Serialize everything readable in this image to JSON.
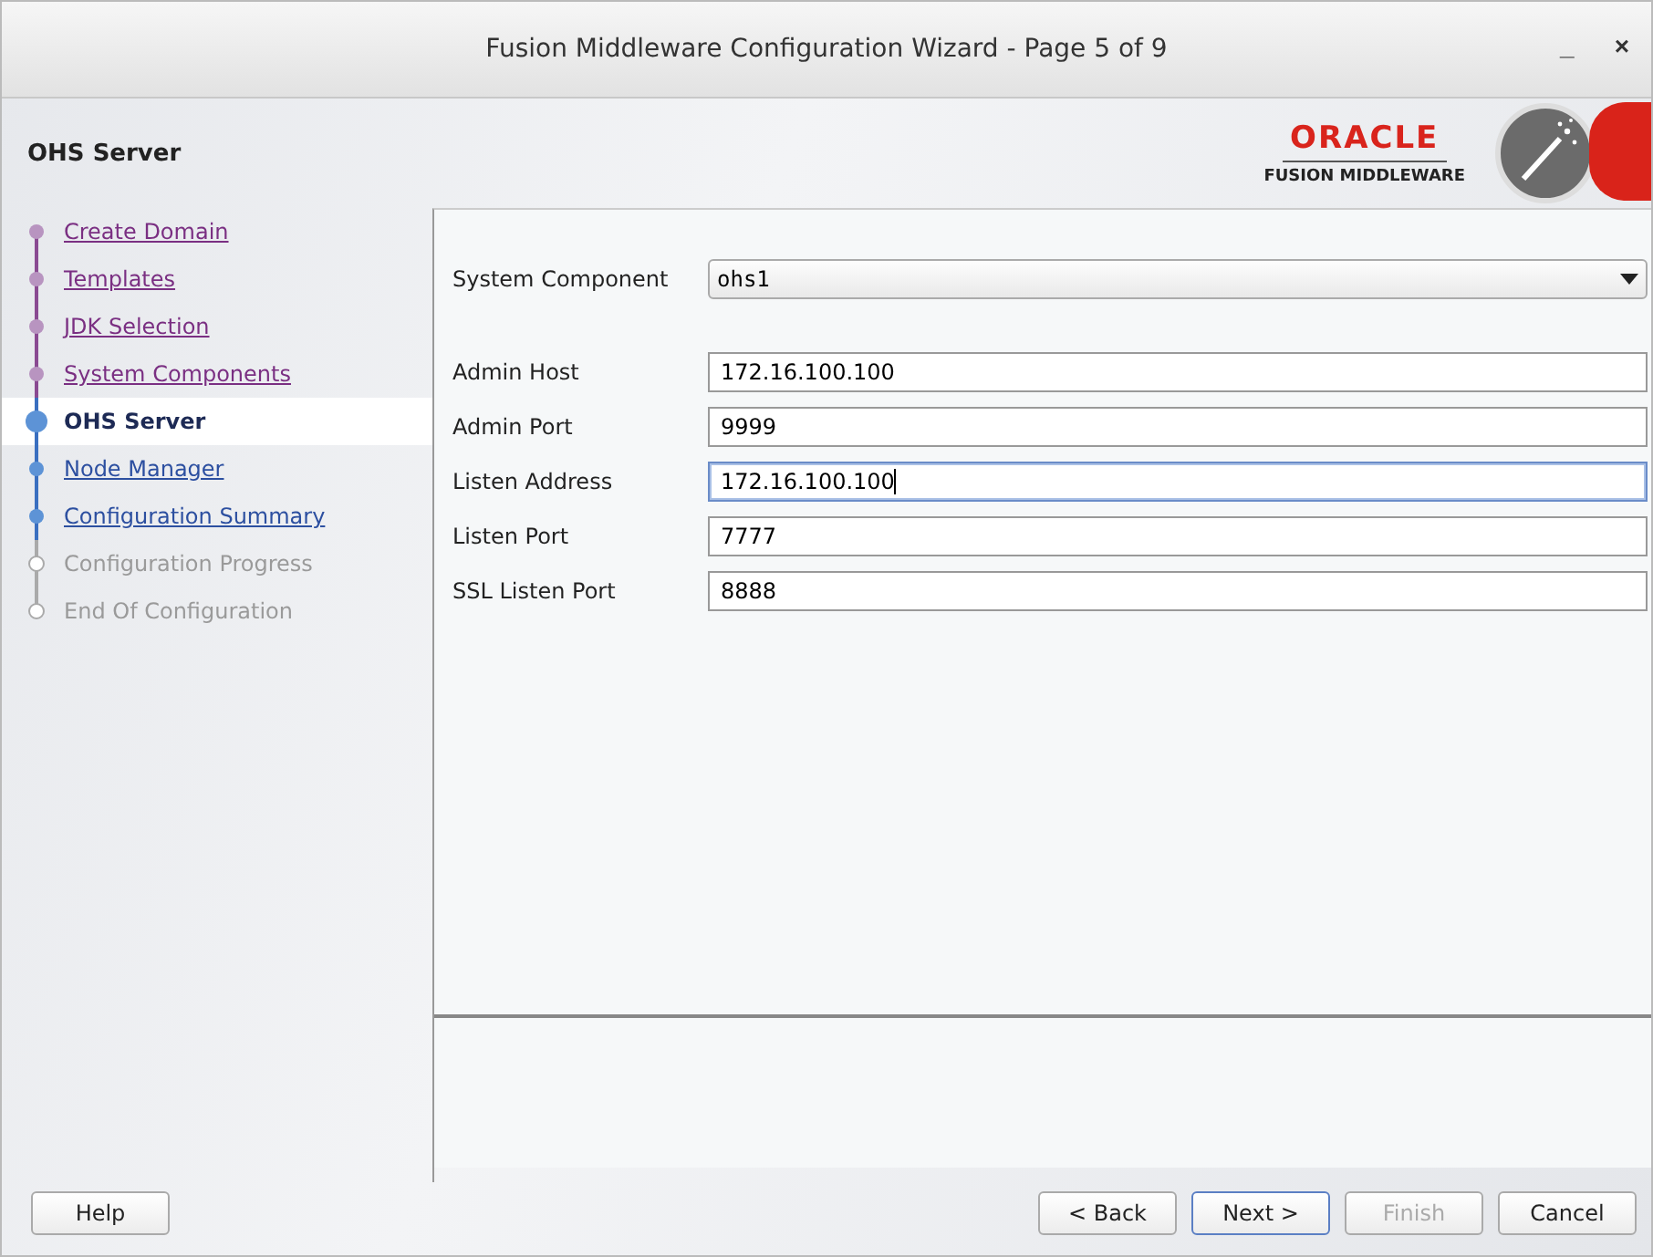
{
  "window": {
    "title": "Fusion Middleware Configuration Wizard - Page 5 of 9",
    "controls": [
      "_",
      "×"
    ]
  },
  "header": {
    "title": "OHS Server",
    "logo_brand": "ORACLE",
    "logo_product": "FUSION MIDDLEWARE"
  },
  "steps": [
    {
      "label": "Create Domain",
      "visited": true,
      "selected": false,
      "disabled": false
    },
    {
      "label": "Templates",
      "visited": true,
      "selected": false,
      "disabled": false
    },
    {
      "label": "JDK Selection",
      "visited": true,
      "selected": false,
      "disabled": false
    },
    {
      "label": "System Components",
      "visited": true,
      "selected": false,
      "disabled": false
    },
    {
      "label": "OHS Server",
      "visited": false,
      "selected": true,
      "disabled": false
    },
    {
      "label": "Node Manager",
      "visited": false,
      "selected": false,
      "disabled": false
    },
    {
      "label": "Configuration Summary",
      "visited": false,
      "selected": false,
      "disabled": false
    },
    {
      "label": "Configuration Progress",
      "selected": false,
      "disabled": true
    },
    {
      "label": "End Of Configuration",
      "selected": false,
      "disabled": true
    }
  ],
  "component": {
    "label": "System Component",
    "value": "ohs1"
  },
  "fields": [
    {
      "label": "Admin Host",
      "value": "172.16.100.100",
      "focused": false
    },
    {
      "label": "Admin Port",
      "value": "9999",
      "focused": false
    },
    {
      "label": "Listen Address",
      "value": "172.16.100.100",
      "focused": true
    },
    {
      "label": "Listen Port",
      "value": "7777",
      "focused": false
    },
    {
      "label": "SSL Listen Port",
      "value": "8888",
      "focused": false
    }
  ],
  "buttons": [
    {
      "label": "Help",
      "disabled": false,
      "default": false
    },
    {
      "label": "< Back",
      "disabled": false,
      "default": false
    },
    {
      "label": "Next >",
      "disabled": false,
      "default": true
    },
    {
      "label": "Finish",
      "disabled": true,
      "default": false
    },
    {
      "label": "Cancel",
      "disabled": false,
      "default": false
    }
  ]
}
